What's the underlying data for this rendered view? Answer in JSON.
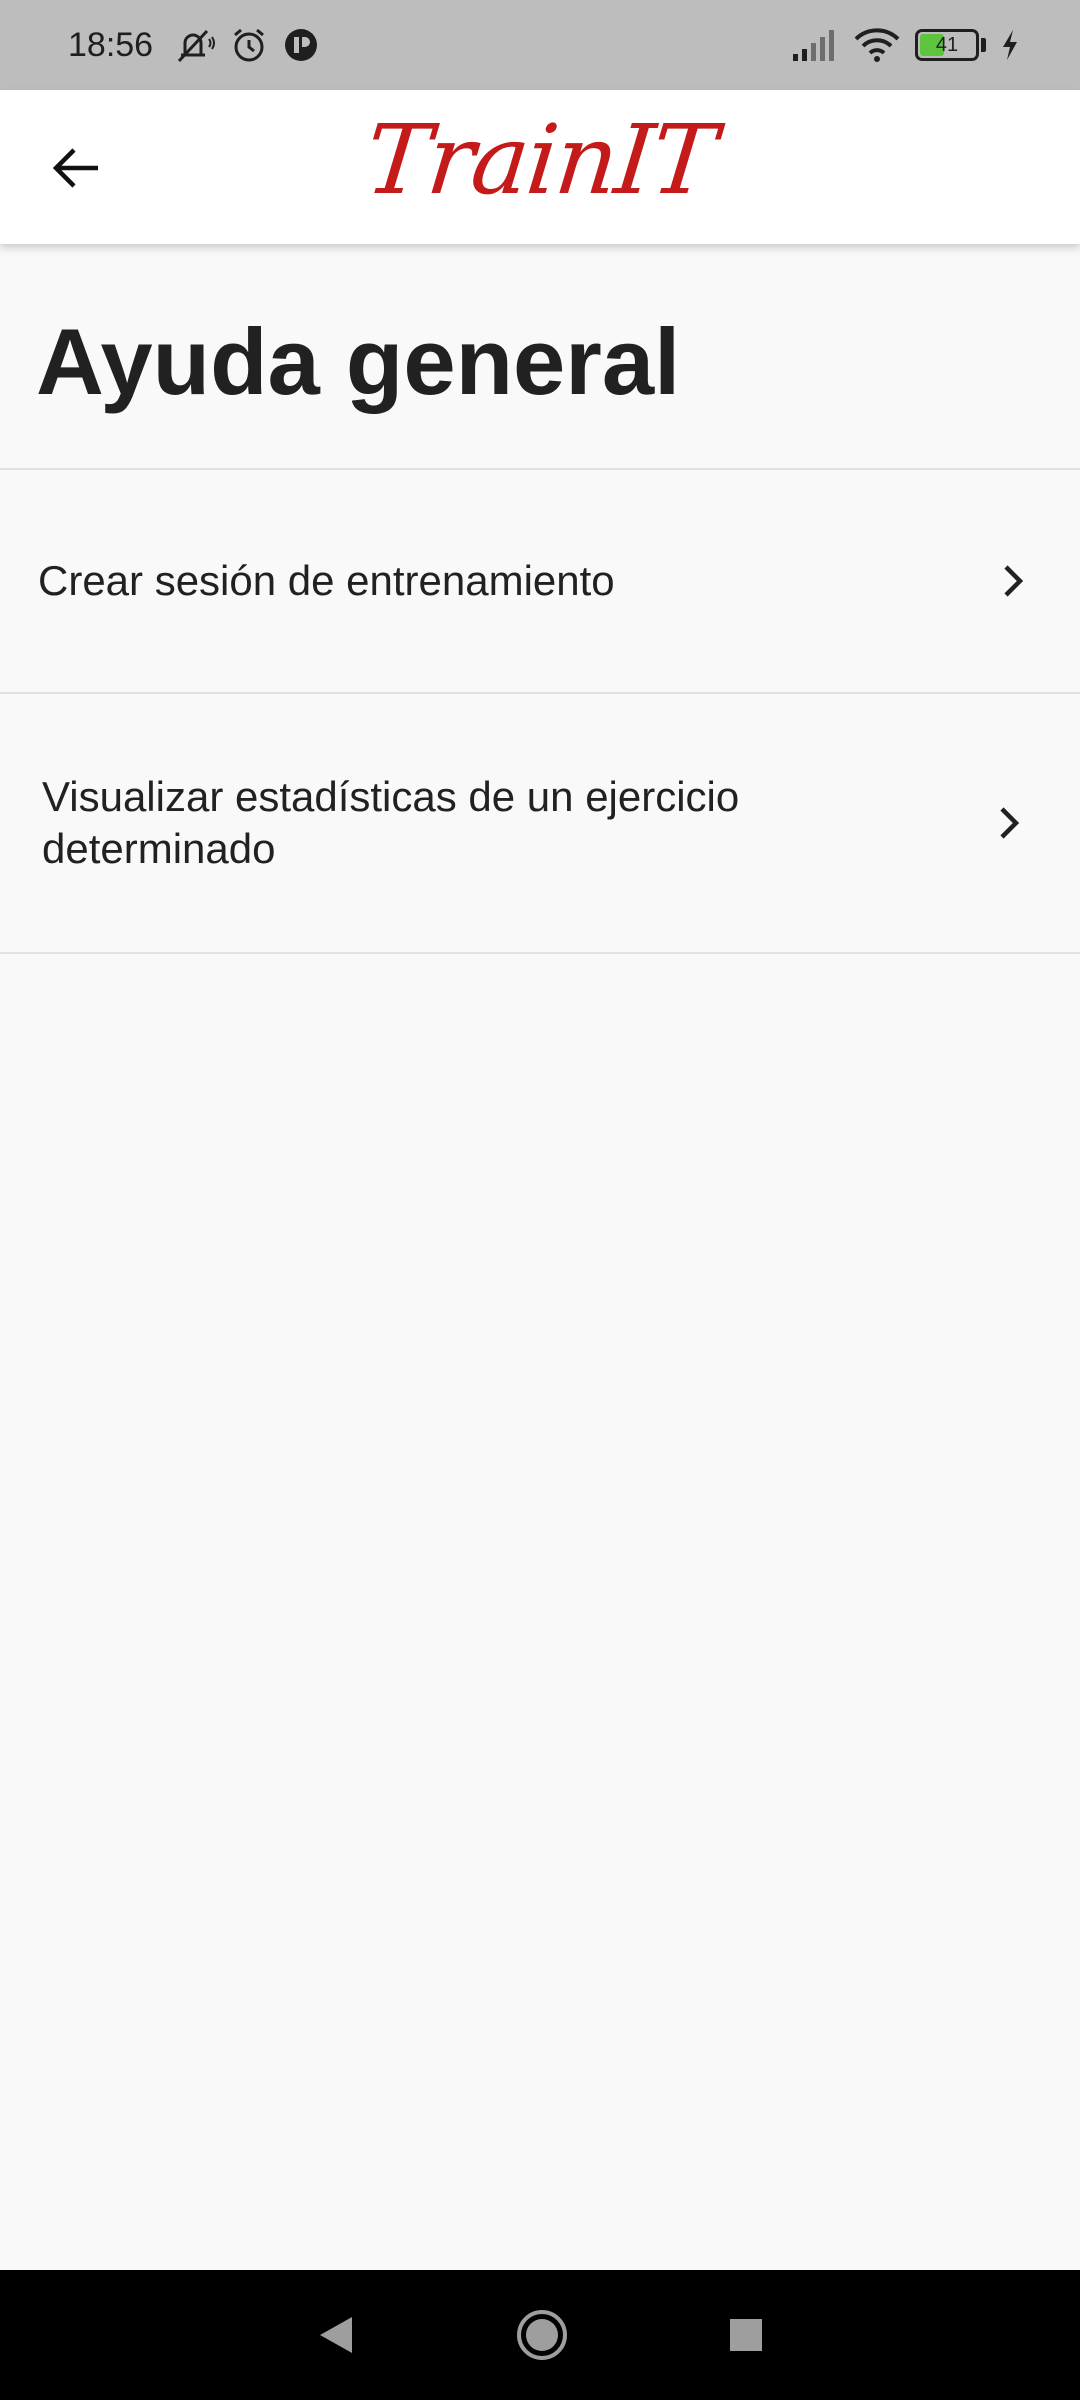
{
  "status_bar": {
    "time": "18:56",
    "battery_level": "41",
    "icons": [
      "mute-icon",
      "alarm-icon",
      "app-notification-icon",
      "signal-icon",
      "wifi-icon",
      "battery-icon",
      "charging-icon"
    ]
  },
  "app_bar": {
    "logo_text": "TrainIT",
    "back_icon": "arrow-left-icon",
    "logo_color": "#c41a1a"
  },
  "page": {
    "title": "Ayuda general"
  },
  "help_items": [
    {
      "label": "Crear sesión de entrenamiento",
      "icon": "chevron-right-icon"
    },
    {
      "label": "Visualizar estadísticas de un ejercicio determinado",
      "icon": "chevron-right-icon"
    }
  ],
  "nav_bar": {
    "icons": [
      "nav-back-icon",
      "nav-home-icon",
      "nav-recents-icon"
    ]
  }
}
